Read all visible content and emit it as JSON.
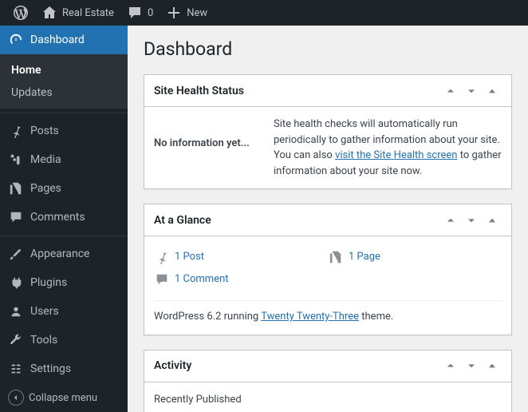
{
  "adminbar": {
    "site_name": "Real Estate",
    "comments_count": "0",
    "new_label": "New"
  },
  "sidebar": {
    "dashboard": "Dashboard",
    "submenu": {
      "home": "Home",
      "updates": "Updates"
    },
    "posts": "Posts",
    "media": "Media",
    "pages": "Pages",
    "comments": "Comments",
    "appearance": "Appearance",
    "plugins": "Plugins",
    "users": "Users",
    "tools": "Tools",
    "settings": "Settings",
    "collapse": "Collapse menu"
  },
  "page": {
    "title": "Dashboard"
  },
  "site_health": {
    "title": "Site Health Status",
    "no_info": "No information yet...",
    "desc_prefix": "Site health checks will automatically run periodically to gather information about your site. You can also ",
    "link_text": "visit the Site Health screen",
    "desc_suffix": " to gather information about your site now."
  },
  "glance": {
    "title": "At a Glance",
    "post": "1 Post",
    "page": "1 Page",
    "comment": "1 Comment",
    "version_prefix": "WordPress 6.2 running ",
    "theme_link": "Twenty Twenty-Three",
    "version_suffix": " theme."
  },
  "activity": {
    "title": "Activity",
    "recently_published": "Recently Published"
  }
}
